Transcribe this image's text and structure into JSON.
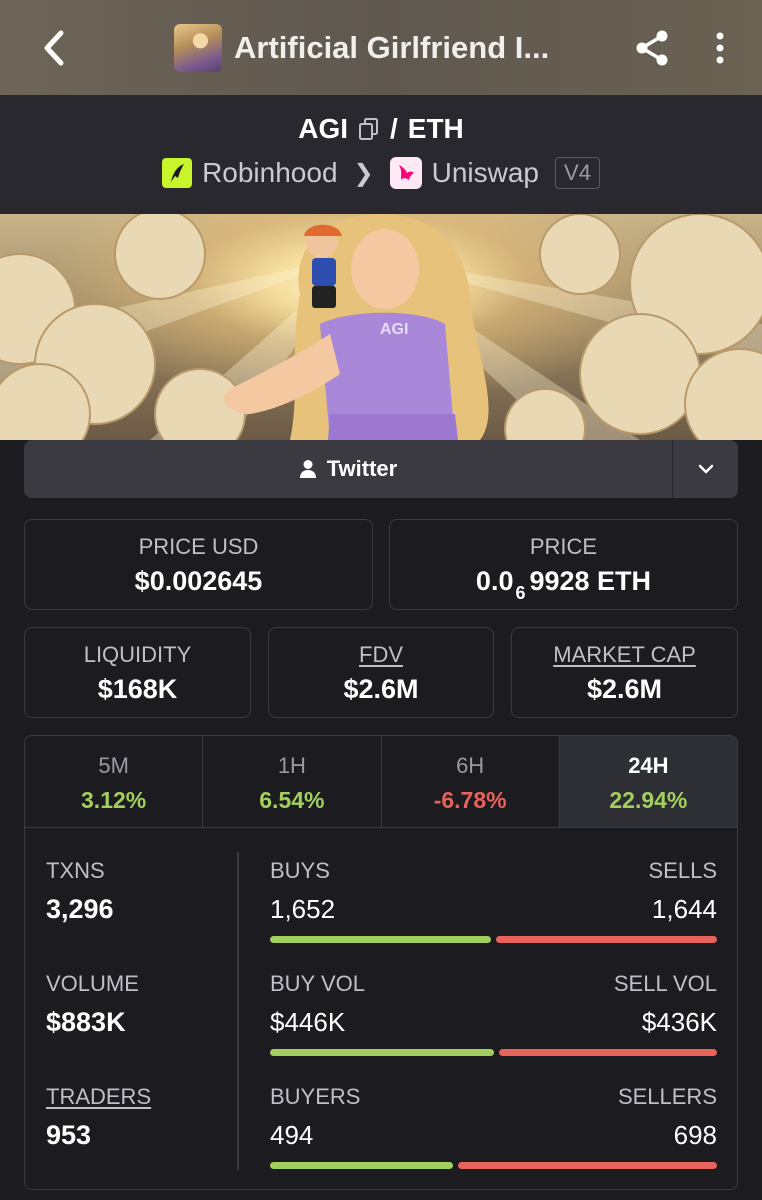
{
  "appbar": {
    "title": "Artificial Girlfriend I...",
    "back_icon": "chevron-left-icon",
    "share_icon": "share-icon",
    "more_icon": "more-vertical-icon"
  },
  "pair": {
    "base": "AGI",
    "separator": "/",
    "quote": "ETH",
    "chain": "Robinhood",
    "dex": "Uniswap",
    "version": "V4"
  },
  "twitter": {
    "label": "Twitter"
  },
  "price": {
    "usd_label": "PRICE USD",
    "usd_value": "$0.002645",
    "native_label": "PRICE",
    "native_prefix": "0.0",
    "native_zeros": "6",
    "native_digits": "9928 ETH"
  },
  "metrics": {
    "liquidity_label": "LIQUIDITY",
    "liquidity_value": "$168K",
    "fdv_label": "FDV",
    "fdv_value": "$2.6M",
    "mcap_label": "MARKET CAP",
    "mcap_value": "$2.6M"
  },
  "timeframes": [
    {
      "label": "5M",
      "change": "3.12%",
      "direction": "up"
    },
    {
      "label": "1H",
      "change": "6.54%",
      "direction": "up"
    },
    {
      "label": "6H",
      "change": "-6.78%",
      "direction": "down"
    },
    {
      "label": "24H",
      "change": "22.94%",
      "direction": "up",
      "active": true
    }
  ],
  "stats": {
    "txns": {
      "label": "TXNS",
      "value": "3,296"
    },
    "volume": {
      "label": "VOLUME",
      "value": "$883K"
    },
    "traders": {
      "label": "TRADERS",
      "value": "953"
    },
    "buys": {
      "left_label": "BUYS",
      "left_value": "1,652",
      "right_label": "SELLS",
      "right_value": "1,644",
      "buy_share": 0.501
    },
    "vol": {
      "left_label": "BUY VOL",
      "left_value": "$446K",
      "right_label": "SELL VOL",
      "right_value": "$436K",
      "buy_share": 0.506
    },
    "buyers": {
      "left_label": "BUYERS",
      "left_value": "494",
      "right_label": "SELLERS",
      "right_value": "698",
      "buy_share": 0.414
    }
  },
  "colors": {
    "positive": "#a3cf5f",
    "negative": "#e8635c",
    "background": "#1b1b20",
    "robinhood": "#c7f42b",
    "uniswap": "#ff007a"
  }
}
